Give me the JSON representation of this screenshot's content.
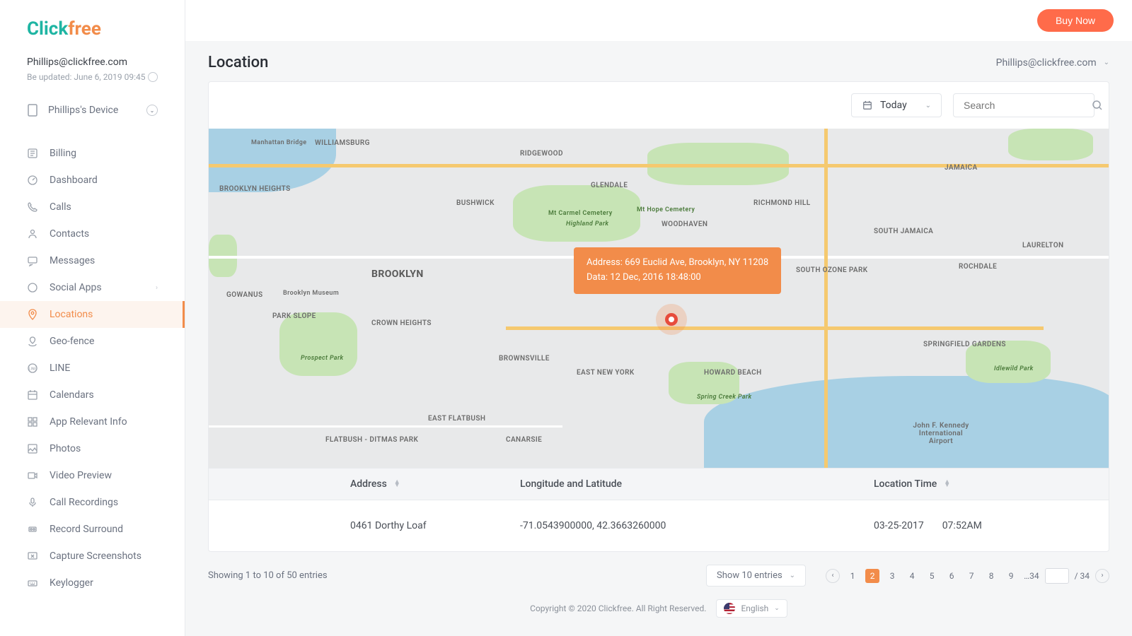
{
  "logo": {
    "part1": "Click",
    "part2": "free"
  },
  "user": {
    "email": "Phillips@clickfree.com",
    "updated": "Be updated: June 6, 2019 09:45",
    "device": "Phillips's Device"
  },
  "nav": {
    "items": [
      {
        "label": "Billing"
      },
      {
        "label": "Dashboard"
      },
      {
        "label": "Calls"
      },
      {
        "label": "Contacts"
      },
      {
        "label": "Messages"
      },
      {
        "label": "Social Apps",
        "hasChildren": true
      },
      {
        "label": "Locations",
        "active": true
      },
      {
        "label": "Geo-fence"
      },
      {
        "label": "LINE"
      },
      {
        "label": "Calendars"
      },
      {
        "label": "App Relevant Info"
      },
      {
        "label": "Photos"
      },
      {
        "label": "Video Preview"
      },
      {
        "label": "Call Recordings"
      },
      {
        "label": "Record Surround"
      },
      {
        "label": "Capture Screenshots"
      },
      {
        "label": "Keylogger"
      }
    ]
  },
  "topbar": {
    "buy": "Buy Now"
  },
  "page": {
    "title": "Location",
    "header_user": "Phillips@clickfree.com"
  },
  "filters": {
    "date_label": "Today",
    "search_placeholder": "Search"
  },
  "map": {
    "tooltip_line1": "Address: 669 Euclid Ave, Brooklyn, NY 11208",
    "tooltip_line2": "Data: 12 Dec, 2016  18:48:00",
    "labels": {
      "williamsburg": "WILLIAMSBURG",
      "ridgewood": "RIDGEWOOD",
      "glendale": "GLENDALE",
      "brooklyn": "BROOKLYN",
      "brooklyn_heights": "BROOKLYN HEIGHTS",
      "bushwick": "BUSHWICK",
      "gowanus": "GOWANUS",
      "crown_heights": "CROWN HEIGHTS",
      "brownsville": "BROWNSVILLE",
      "east_flatbush": "EAST FLATBUSH",
      "canarsie": "CANARSIE",
      "east_new_york": "EAST NEW YORK",
      "howard_beach": "HOWARD BEACH",
      "woodhaven": "WOODHAVEN",
      "richmond_hill": "RICHMOND HILL",
      "south_ozone": "SOUTH OZONE PARK",
      "jamaica": "JAMAICA",
      "south_jamaica": "SOUTH JAMAICA",
      "rochdale": "ROCHDALE",
      "laurelton": "LAURELTON",
      "springfield": "SPRINGFIELD GARDENS",
      "jfk": "John F. Kennedy International Airport",
      "park_slope": "PARK SLOPE",
      "flatbush": "FLATBUSH - DITMAS PARK",
      "highland": "Highland Park",
      "carmel": "Mt Carmel Cemetery",
      "hope": "Mt Hope Cemetery",
      "museum": "Brooklyn Museum",
      "prospect": "Prospect Park",
      "spring_creek": "Spring Creek Park",
      "idlewild": "Idlewild Park",
      "manhattan_bridge": "Manhattan Bridge"
    }
  },
  "table": {
    "headers": {
      "address": "Address",
      "coord": "Longitude and Latitude",
      "time": "Location Time"
    },
    "row": {
      "address": "0461 Dorthy Loaf",
      "coord": "-71.0543900000, 42.3663260000",
      "date": "03-25-2017",
      "time": "07:52AM"
    }
  },
  "footer": {
    "showing": "Showing 1 to 10 of 50 entries",
    "entries_label": "Show 10 entries",
    "pages": [
      "1",
      "2",
      "3",
      "4",
      "5",
      "6",
      "7",
      "8",
      "9"
    ],
    "ellipsis": "…34",
    "total_suffix": "/ 34",
    "copyright": "Copyright © 2020 Clickfree. All Right Reserved.",
    "lang": "English"
  }
}
